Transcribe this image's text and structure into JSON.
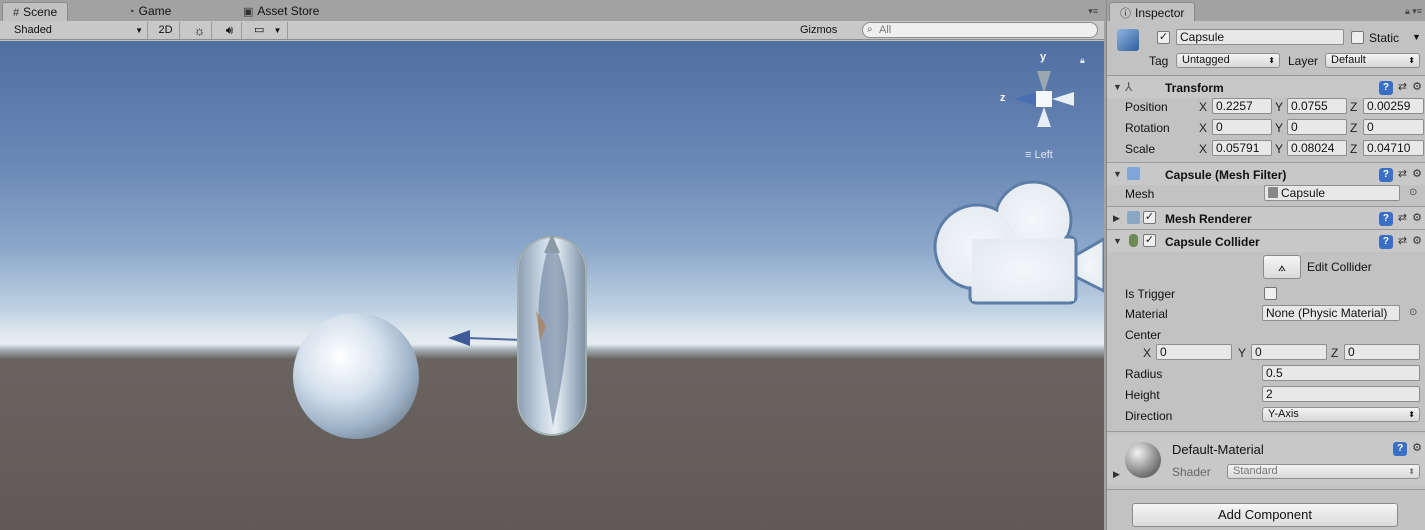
{
  "scene_tabs": [
    {
      "label": "Scene",
      "icon": "grid-icon"
    },
    {
      "label": "Game",
      "icon": "pacman-icon"
    },
    {
      "label": "Asset Store",
      "icon": "bag-icon"
    }
  ],
  "toolbar": {
    "draw_mode": "Shaded",
    "mode_2d": "2D",
    "gizmos": "Gizmos",
    "search_placeholder": "All"
  },
  "viewport": {
    "gizmo_y": "y",
    "gizmo_z": "z",
    "view_label": "Left"
  },
  "inspector": {
    "tab": "Inspector",
    "object": {
      "name": "Capsule",
      "active": true,
      "static_label": "Static",
      "static": false,
      "tag_label": "Tag",
      "tag": "Untagged",
      "layer_label": "Layer",
      "layer": "Default"
    },
    "transform": {
      "title": "Transform",
      "position_label": "Position",
      "rotation_label": "Rotation",
      "scale_label": "Scale",
      "x": "X",
      "y": "Y",
      "z": "Z",
      "position": [
        "0.2257",
        "0.0755",
        "0.00259"
      ],
      "rotation": [
        "0",
        "0",
        "0"
      ],
      "scale": [
        "0.05791",
        "0.08024",
        "0.04710"
      ]
    },
    "mesh_filter": {
      "title": "Capsule (Mesh Filter)",
      "mesh_label": "Mesh",
      "mesh": "Capsule"
    },
    "mesh_renderer": {
      "title": "Mesh Renderer",
      "enabled": true
    },
    "capsule_collider": {
      "title": "Capsule Collider",
      "enabled": true,
      "edit_collider": "Edit Collider",
      "is_trigger_label": "Is Trigger",
      "is_trigger": false,
      "material_label": "Material",
      "material": "None (Physic Material)",
      "center_label": "Center",
      "center": [
        "0",
        "0",
        "0"
      ],
      "radius_label": "Radius",
      "radius": "0.5",
      "height_label": "Height",
      "height": "2",
      "direction_label": "Direction",
      "direction": "Y-Axis"
    },
    "material": {
      "name": "Default-Material",
      "shader_label": "Shader",
      "shader": "Standard"
    },
    "add_component": "Add Component"
  },
  "colors": {
    "help_icon": "#3a6fc6",
    "sky_top": "#4f6fa2",
    "ground": "#5f5a57"
  }
}
